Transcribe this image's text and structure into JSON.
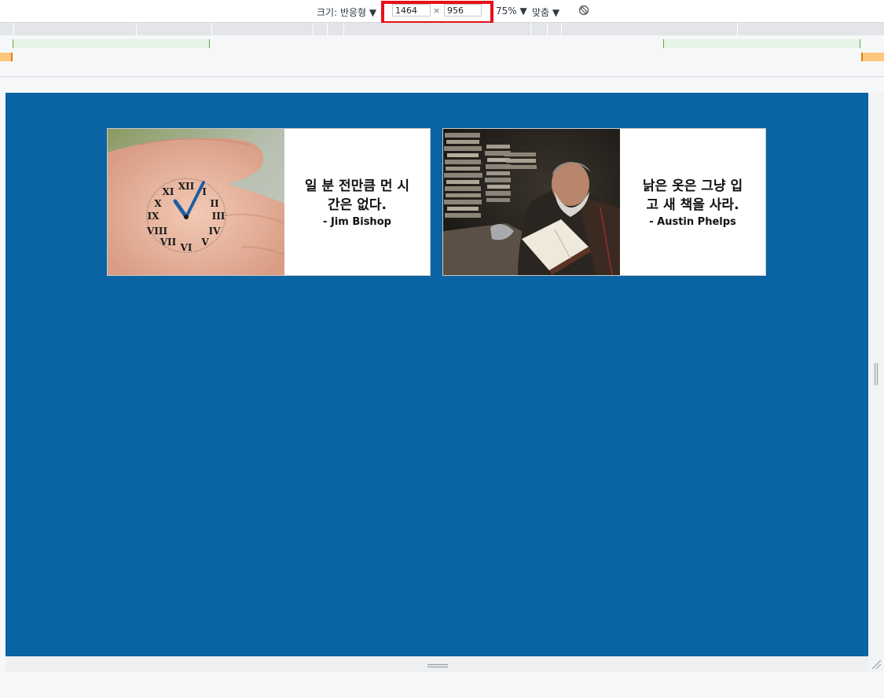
{
  "toolbar": {
    "size_label": "크기: 반응형 ▼",
    "width_value": "1464",
    "height_value": "956",
    "times_symbol": "×",
    "zoom": "75% ▼",
    "fit": "맞춤 ▼"
  },
  "colors": {
    "viewport_bg": "#0a63a2",
    "highlight": "#e8101a"
  },
  "cards": [
    {
      "image": "hand-clock-photo",
      "quote": "일 분 전만큼 먼 시간은 없다.",
      "author": "- Jim Bishop"
    },
    {
      "image": "old-man-reading-photo",
      "quote": "낡은 옷은 그냥 입고 새 책을 사라.",
      "author": "- Austin Phelps"
    }
  ]
}
